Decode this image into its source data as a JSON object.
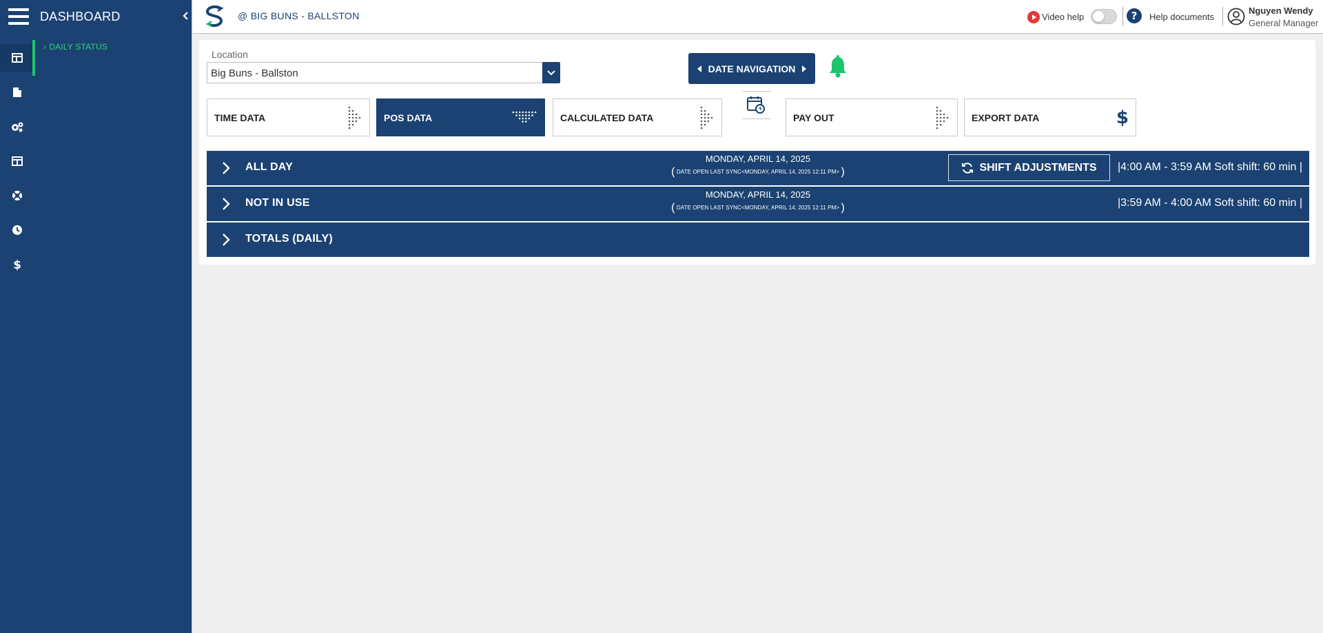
{
  "sidebar": {
    "title": "DASHBOARD",
    "items": [
      {
        "label": "DAILY STATUS"
      }
    ]
  },
  "rail": {
    "icons": [
      "dashboard-icon",
      "document-icon",
      "settings-icon",
      "table-icon",
      "support-icon",
      "clock-icon",
      "dollar-icon"
    ]
  },
  "header": {
    "org": "@ BIG BUNS - BALLSTON",
    "video_help": "Video help",
    "help_documents": "Help documents",
    "user_name": "Nguyen Wendy",
    "user_role": "General Manager"
  },
  "location": {
    "label": "Location",
    "value": "Big Buns - Ballston"
  },
  "date_navigation": {
    "label": "DATE NAVIGATION"
  },
  "tabs": [
    {
      "label": "TIME DATA",
      "icon": "dotted-arrow-right-icon",
      "active": false
    },
    {
      "label": "POS DATA",
      "icon": "dotted-arrow-down-icon",
      "active": true
    },
    {
      "label": "CALCULATED DATA",
      "icon": "dotted-arrow-right-icon",
      "active": false
    },
    {
      "label": "PAY OUT",
      "icon": "dotted-arrow-right-icon",
      "active": false
    },
    {
      "label": "EXPORT DATA",
      "icon": "dollar-icon",
      "active": false
    }
  ],
  "rows": [
    {
      "title": "ALL DAY",
      "date": "MONDAY, APRIL 14, 2025",
      "sync": "DATE OPEN LAST SYNC<MONDAY, APRIL 14, 2025 12:11 PM>",
      "hours": "|4:00 AM - 3:59 AM Soft shift: 60 min |",
      "action": "SHIFT ADJUSTMENTS"
    },
    {
      "title": "NOT IN USE",
      "date": "MONDAY, APRIL 14, 2025",
      "sync": "DATE OPEN LAST SYNC<MONDAY, APRIL 14, 2025 12:11 PM>",
      "hours": "|3:59 AM - 4:00 AM Soft shift: 60 min |"
    },
    {
      "title": "TOTALS (DAILY)"
    }
  ],
  "colors": {
    "primary": "#1b4272",
    "accent_green": "#1ec46b",
    "video_red": "#e53935"
  }
}
